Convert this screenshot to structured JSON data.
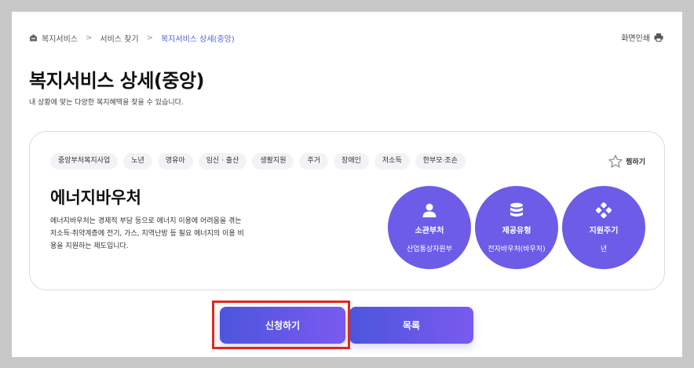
{
  "breadcrumb": {
    "items": [
      "복지서비스",
      "서비스 찾기",
      "복지서비스 상세(중앙)"
    ],
    "separator": ">"
  },
  "header": {
    "print_label": "화면인쇄",
    "title": "복지서비스 상세(중앙)",
    "subtitle": "내 상황에 맞는 다양한 복지혜택을 찾을 수 있습니다."
  },
  "card": {
    "tags": [
      "중앙부처복지사업",
      "노년",
      "영유아",
      "임신 · 출산",
      "생활지원",
      "주거",
      "장애인",
      "저소득",
      "한부모·조손"
    ],
    "bookmark_label": "찜하기",
    "service_name": "에너지바우처",
    "description": "에너지바우처는 경제적 부담 등으로 에너지 이용에 어려움을 겪는 저소득·취약계층에 전기, 가스, 지역난방 등 필요 에너지의 이용 비용을 지원하는 제도입니다.",
    "info": [
      {
        "label": "소관부처",
        "value": "산업통상자원부",
        "icon": "person-icon"
      },
      {
        "label": "제공유형",
        "value": "전자바우처(바우처)",
        "icon": "database-icon"
      },
      {
        "label": "지원주기",
        "value": "년",
        "icon": "diamond-dots-icon"
      }
    ]
  },
  "buttons": {
    "apply_label": "신청하기",
    "list_label": "목록"
  },
  "colors": {
    "accent": "#6c5ce7",
    "breadcrumb_active": "#4b5fd6",
    "highlight": "#e0271f"
  }
}
